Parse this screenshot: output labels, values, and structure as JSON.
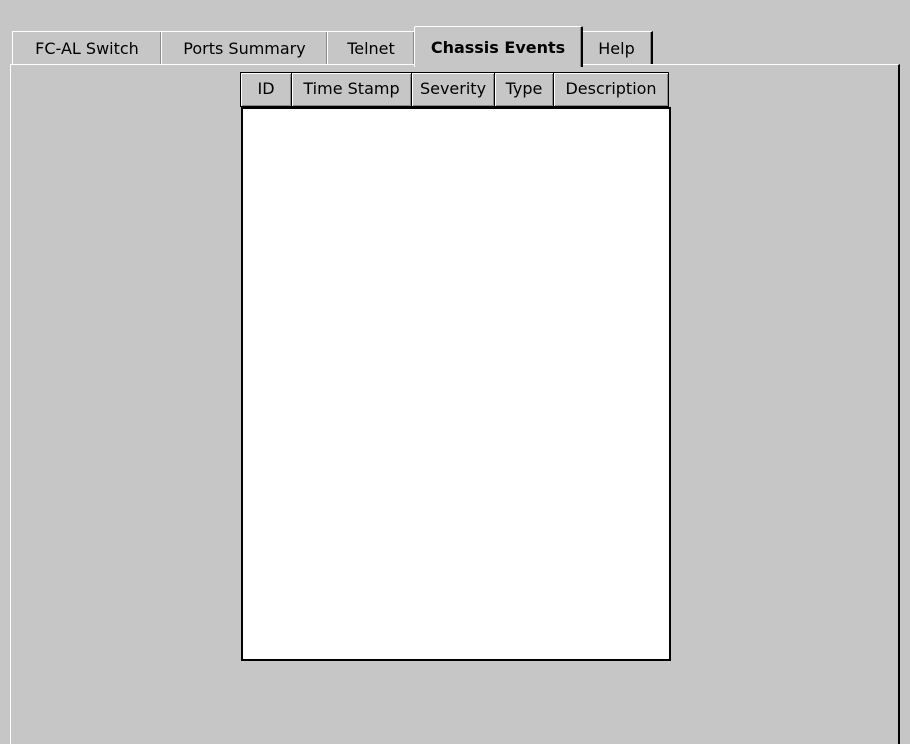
{
  "tabs": [
    {
      "label": "FC-AL Switch",
      "active": false
    },
    {
      "label": "Ports Summary",
      "active": false
    },
    {
      "label": "Telnet",
      "active": false
    },
    {
      "label": "Chassis Events",
      "active": true
    },
    {
      "label": "Help",
      "active": false
    }
  ],
  "events_table": {
    "columns": [
      "ID",
      "Time Stamp",
      "Severity",
      "Type",
      "Description"
    ],
    "rows": []
  }
}
